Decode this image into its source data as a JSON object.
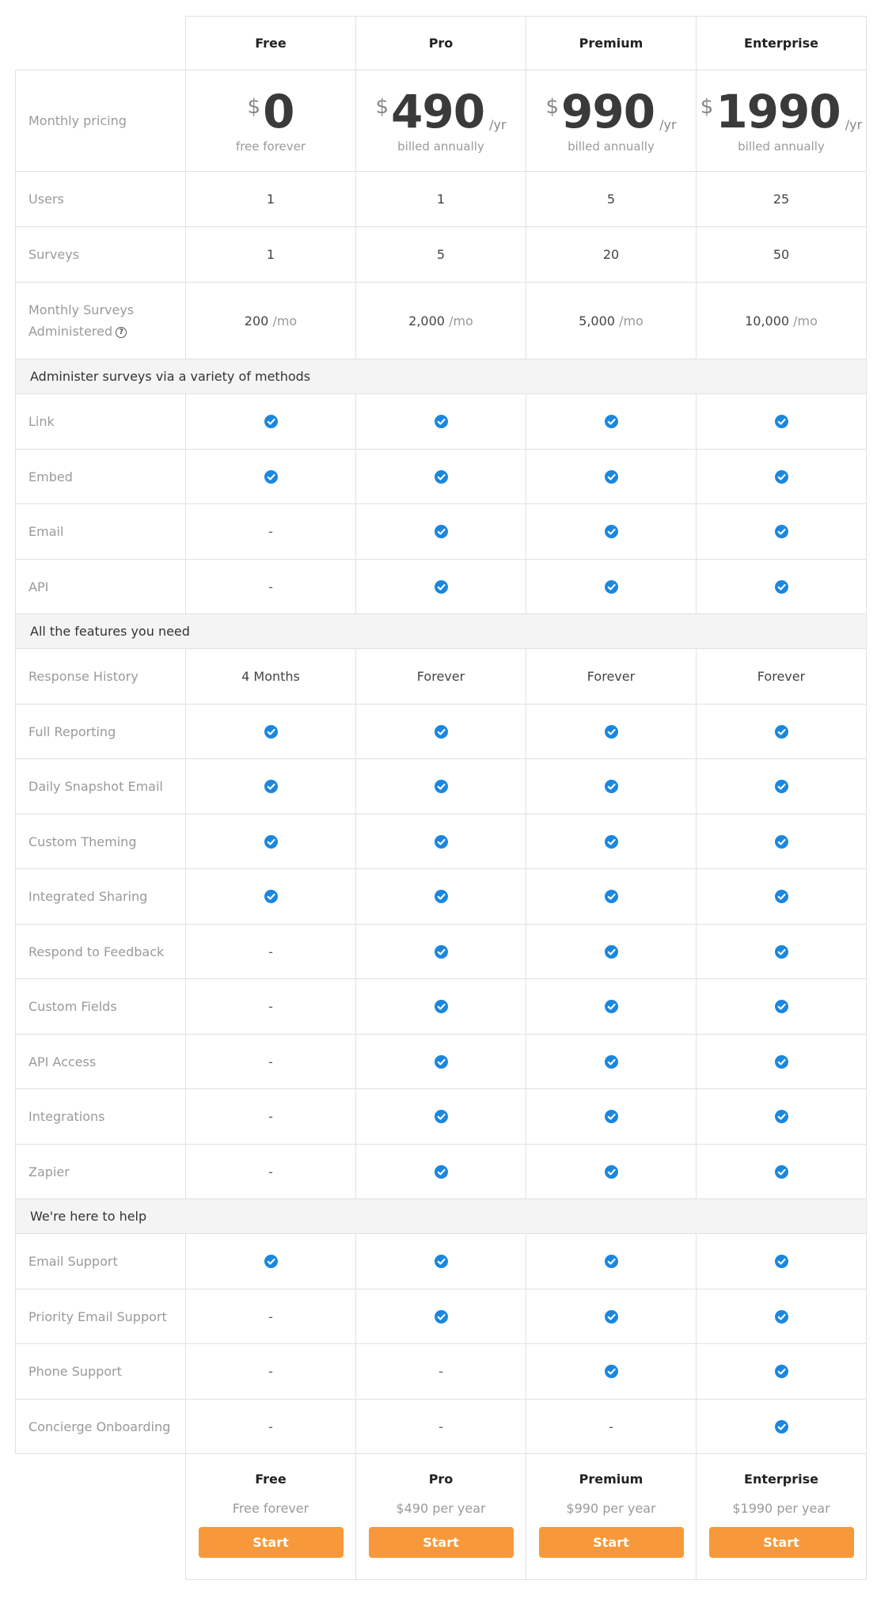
{
  "plans": [
    {
      "name": "Free",
      "currency": "$",
      "price": "0",
      "period": "",
      "billing": "free forever",
      "footer_sub": "Free forever",
      "cta": "Start"
    },
    {
      "name": "Pro",
      "currency": "$",
      "price": "490",
      "period": "/yr",
      "billing": "billed annually",
      "footer_sub": "$490 per year",
      "cta": "Start"
    },
    {
      "name": "Premium",
      "currency": "$",
      "price": "990",
      "period": "/yr",
      "billing": "billed annually",
      "footer_sub": "$990 per year",
      "cta": "Start"
    },
    {
      "name": "Enterprise",
      "currency": "$",
      "price": "1990",
      "period": "/yr",
      "billing": "billed annually",
      "footer_sub": "$1990 per year",
      "cta": "Start"
    }
  ],
  "pricing_label": "Monthly pricing",
  "limits": [
    {
      "label": "Users",
      "values": [
        "1",
        "1",
        "5",
        "25"
      ]
    },
    {
      "label": "Surveys",
      "values": [
        "1",
        "5",
        "20",
        "50"
      ]
    },
    {
      "label_line1": "Monthly Surveys",
      "label_line2": "Administered",
      "help_icon": "question-circle-icon",
      "values": [
        "200",
        "2,000",
        "5,000",
        "10,000"
      ],
      "unit": "/mo"
    }
  ],
  "sections": [
    {
      "title": "Administer surveys via a variety of methods",
      "rows": [
        {
          "label": "Link",
          "values": [
            true,
            true,
            true,
            true
          ]
        },
        {
          "label": "Embed",
          "values": [
            true,
            true,
            true,
            true
          ]
        },
        {
          "label": "Email",
          "values": [
            false,
            true,
            true,
            true
          ]
        },
        {
          "label": "API",
          "values": [
            false,
            true,
            true,
            true
          ]
        }
      ]
    },
    {
      "title": "All the features you need",
      "rows": [
        {
          "label": "Response History",
          "values": [
            "4 Months",
            "Forever",
            "Forever",
            "Forever"
          ]
        },
        {
          "label": "Full Reporting",
          "values": [
            true,
            true,
            true,
            true
          ]
        },
        {
          "label": "Daily Snapshot Email",
          "values": [
            true,
            true,
            true,
            true
          ]
        },
        {
          "label": "Custom Theming",
          "values": [
            true,
            true,
            true,
            true
          ]
        },
        {
          "label": "Integrated Sharing",
          "values": [
            true,
            true,
            true,
            true
          ]
        },
        {
          "label": "Respond to Feedback",
          "values": [
            false,
            true,
            true,
            true
          ]
        },
        {
          "label": "Custom Fields",
          "values": [
            false,
            true,
            true,
            true
          ]
        },
        {
          "label": "API Access",
          "values": [
            false,
            true,
            true,
            true
          ]
        },
        {
          "label": "Integrations",
          "values": [
            false,
            true,
            true,
            true
          ]
        },
        {
          "label": "Zapier",
          "values": [
            false,
            true,
            true,
            true
          ]
        }
      ]
    },
    {
      "title": "We're here to help",
      "rows": [
        {
          "label": "Email Support",
          "values": [
            true,
            true,
            true,
            true
          ]
        },
        {
          "label": "Priority Email Support",
          "values": [
            false,
            true,
            true,
            true
          ]
        },
        {
          "label": "Phone Support",
          "values": [
            false,
            false,
            true,
            true
          ]
        },
        {
          "label": "Concierge Onboarding",
          "values": [
            false,
            false,
            false,
            true
          ]
        }
      ]
    }
  ],
  "symbols": {
    "unavailable": "-",
    "included_icon": "check-circle-icon",
    "help_glyph": "?"
  },
  "colors": {
    "check": "#1a87e0",
    "cta": "#f7993a",
    "section_bg": "#f4f4f4",
    "border": "#e1e1e1"
  }
}
